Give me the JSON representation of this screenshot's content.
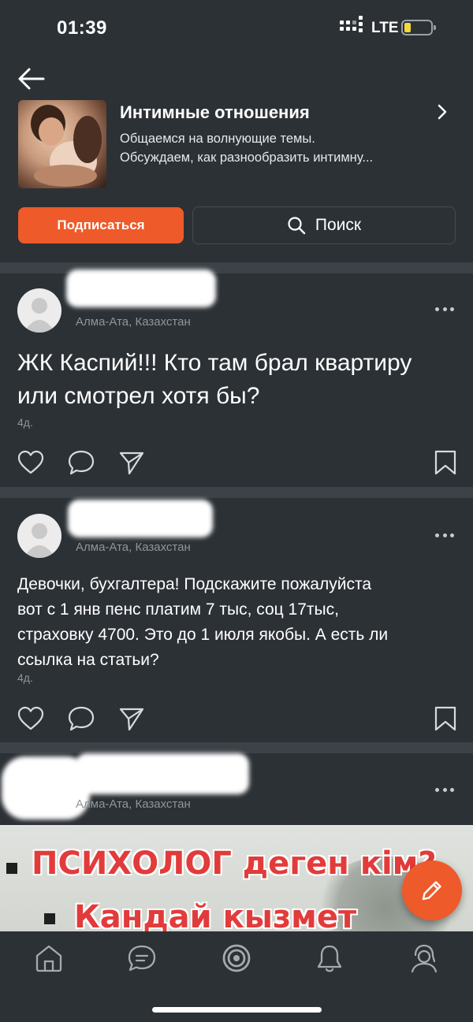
{
  "status_bar": {
    "time": "01:39",
    "network": "LTE"
  },
  "group": {
    "title": "Интимные отношения",
    "description_line1": "Общаемся на волнующие темы.",
    "description_line2": "Обсуждаем, как разнообразить интимну..."
  },
  "actions": {
    "subscribe_label": "Подписаться",
    "search_label": "Поиск"
  },
  "posts": [
    {
      "location": "Алма-Ата, Казахстан",
      "text_line1": "ЖК Каспий!!! Кто там брал квартиру",
      "text_line2": "или смотрел хотя бы?",
      "age": "4д."
    },
    {
      "location": "Алма-Ата, Казахстан",
      "text_lines": [
        "Девочки, бухгалтера! Подскажите пожалуйста",
        "вот с 1 янв пенс платим 7 тыс, соц 17тыс,",
        "страховку 4700. Это до 1 июля якобы. А есть ли",
        "ссылка на статьи?"
      ],
      "age": "4д."
    },
    {
      "location": "Алма-Ата, Казахстан",
      "image_line1": "ПСИХОЛОГ деген кім?",
      "image_line2": "Кандай кызмет"
    }
  ],
  "colors": {
    "background": "#2c3136",
    "accent": "#ee5a2a",
    "separator": "#3d4248",
    "muted_text": "#8d959c"
  },
  "nav": [
    "home-icon",
    "chat-icon",
    "discover-icon",
    "bell-icon",
    "profile-icon"
  ]
}
